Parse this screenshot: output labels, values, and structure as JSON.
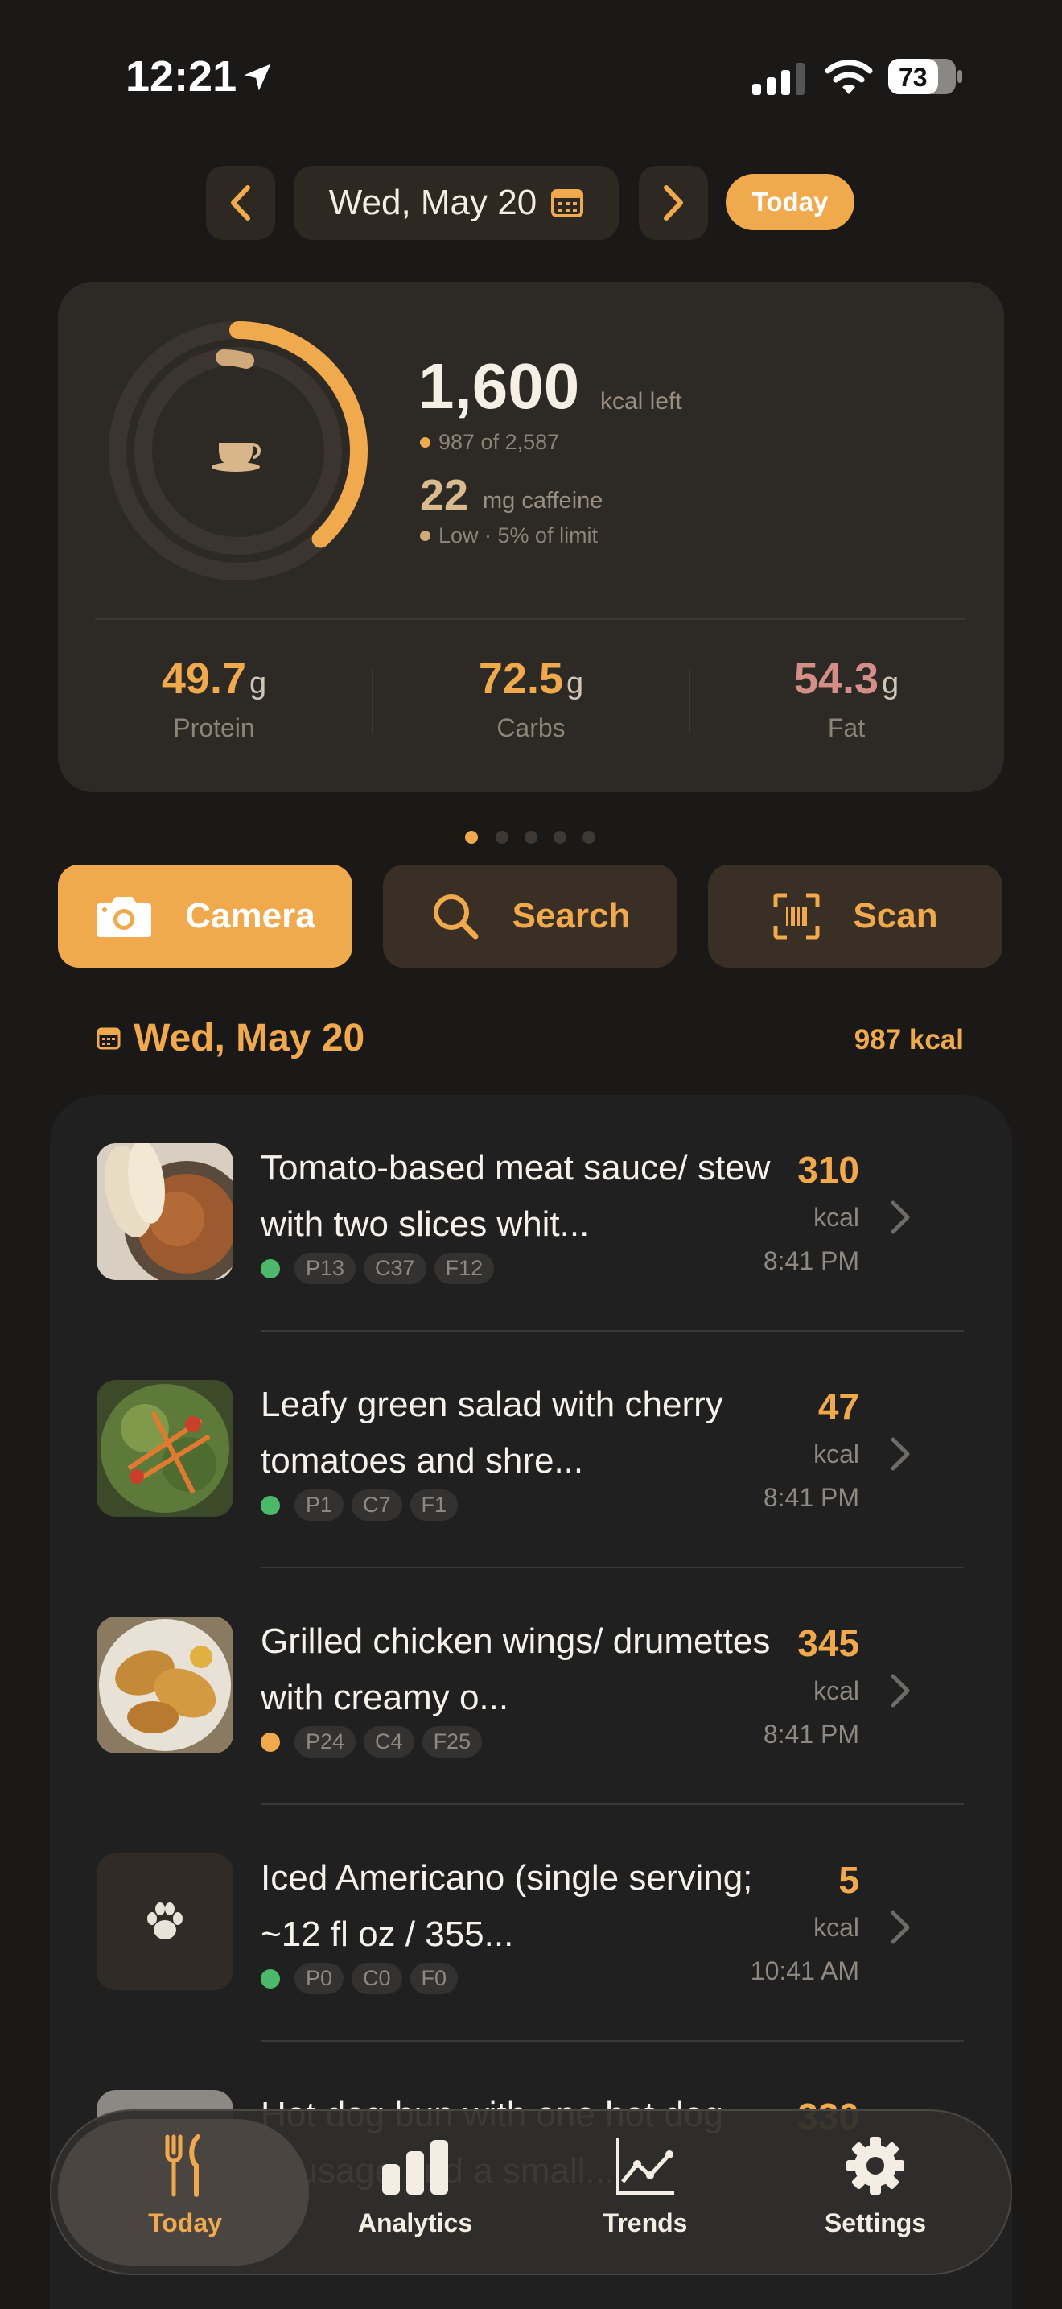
{
  "status_bar": {
    "time": "12:21",
    "battery": "73"
  },
  "date_nav": {
    "date": "Wed, May 20",
    "today_label": "Today"
  },
  "summary": {
    "kcal_left": "1,600",
    "kcal_left_label": "kcal left",
    "consumed_line": "987 of 2,587",
    "caffeine_value": "22",
    "caffeine_label": "mg caffeine",
    "caffeine_status": "Low · 5% of limit",
    "ring_progress": 0.38,
    "macros": [
      {
        "value": "49.7",
        "unit": "g",
        "name": "Protein",
        "color": "#f0a94c"
      },
      {
        "value": "72.5",
        "unit": "g",
        "name": "Carbs",
        "color": "#f0a94c"
      },
      {
        "value": "54.3",
        "unit": "g",
        "name": "Fat",
        "color": "#d48e88"
      }
    ]
  },
  "pager": {
    "count": 5,
    "active": 0
  },
  "actions": [
    {
      "label": "Camera",
      "icon": "camera-icon"
    },
    {
      "label": "Search",
      "icon": "search-icon"
    },
    {
      "label": "Scan",
      "icon": "barcode-scan-icon"
    }
  ],
  "day": {
    "title": "Wed, May 20",
    "total_kcal": "987 kcal"
  },
  "meals": [
    {
      "name": "Tomato-based meat sauce/ stew with two slices whit...",
      "kcal": "310",
      "unit": "kcal",
      "time": "8:41 PM",
      "tags": [
        "P13",
        "C37",
        "F12"
      ],
      "dot_color": "#4cb86a",
      "thumb": "stew-photo"
    },
    {
      "name": "Leafy green salad with cherry tomatoes and shre...",
      "kcal": "47",
      "unit": "kcal",
      "time": "8:41 PM",
      "tags": [
        "P1",
        "C7",
        "F1"
      ],
      "dot_color": "#4cb86a",
      "thumb": "salad-photo"
    },
    {
      "name": "Grilled chicken wings/ drumettes with creamy o...",
      "kcal": "345",
      "unit": "kcal",
      "time": "8:41 PM",
      "tags": [
        "P24",
        "C4",
        "F25"
      ],
      "dot_color": "#f0a94c",
      "thumb": "wings-photo"
    },
    {
      "name": "Iced Americano (single serving; ~12 fl oz / 355...",
      "kcal": "5",
      "unit": "kcal",
      "time": "10:41 AM",
      "tags": [
        "P0",
        "C0",
        "F0"
      ],
      "dot_color": "#4cb86a",
      "thumb": "paw-icon"
    },
    {
      "name": "Hot dog bun with one hot dog sausage and a small...",
      "kcal": "330",
      "unit": "kcal",
      "time": "",
      "tags": [],
      "dot_color": "#4cb86a",
      "thumb": "hotdog-photo"
    }
  ],
  "tabs": [
    {
      "label": "Today",
      "icon": "fork-knife-icon",
      "active": true
    },
    {
      "label": "Analytics",
      "icon": "bar-chart-icon",
      "active": false
    },
    {
      "label": "Trends",
      "icon": "line-chart-icon",
      "active": false
    },
    {
      "label": "Settings",
      "icon": "gear-icon",
      "active": false
    }
  ]
}
